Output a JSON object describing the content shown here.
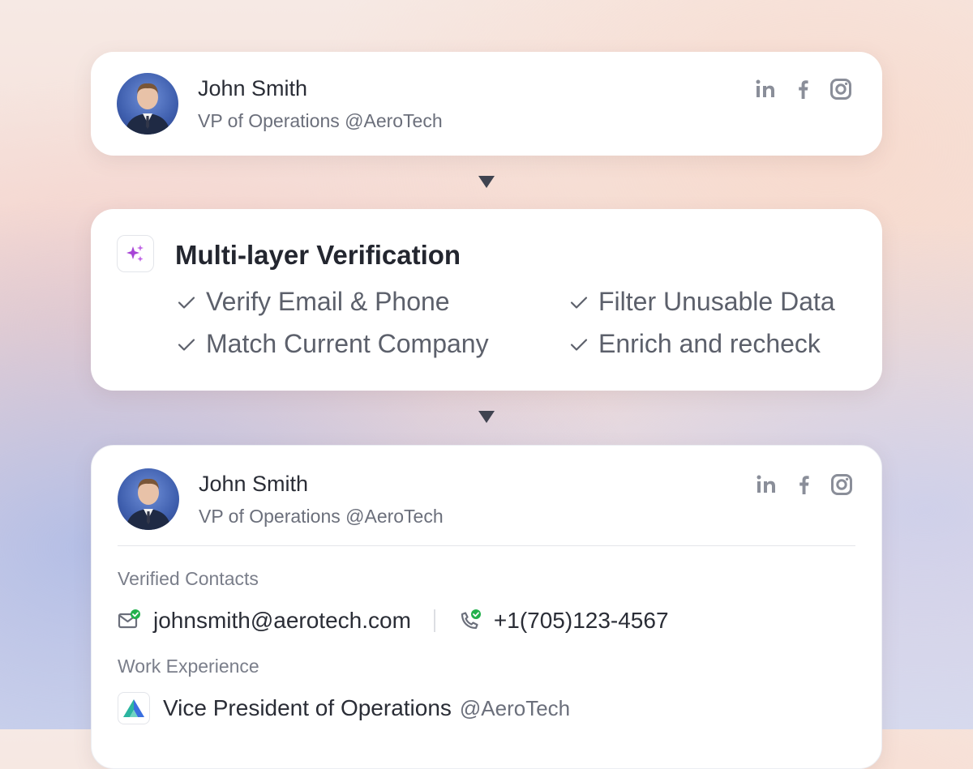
{
  "source_profile": {
    "name": "John Smith",
    "title": "VP of Operations @AeroTech",
    "socials": [
      "linkedin-icon",
      "facebook-icon",
      "instagram-icon"
    ]
  },
  "verification": {
    "heading": "Multi-layer Verification",
    "checks": [
      "Verify Email & Phone",
      "Filter Unusable Data",
      "Match Current Company",
      "Enrich and recheck"
    ]
  },
  "result_profile": {
    "name": "John Smith",
    "title": "VP of Operations @AeroTech",
    "verified_contacts_label": "Verified Contacts",
    "email": "johnsmith@aerotech.com",
    "phone": "+1(705)123-4567",
    "work_experience_label": "Work Experience",
    "role": "Vice President of Operations",
    "company": "@AeroTech"
  },
  "colors": {
    "accent_purple": "#a745d6",
    "verified_green": "#22b14c",
    "logo_teal": "#2bb5a0",
    "logo_blue": "#3a6fe0",
    "icon_gray": "#8a8e99"
  }
}
